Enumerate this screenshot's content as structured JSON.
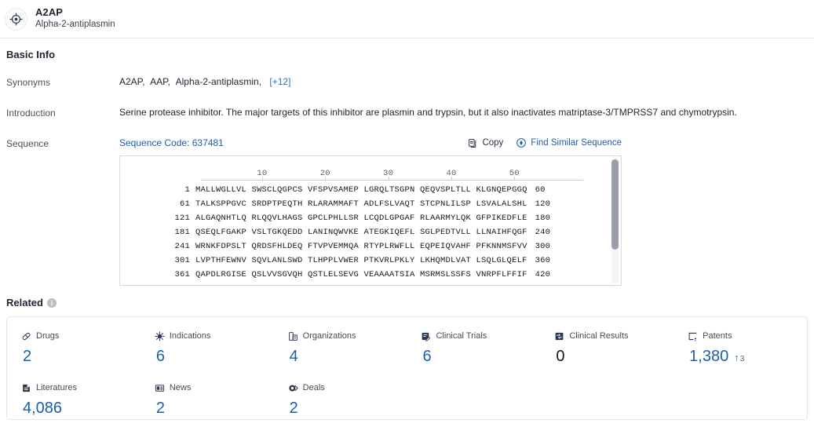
{
  "header": {
    "icon": "target-icon",
    "name": "A2AP",
    "subtitle": "Alpha-2-antiplasmin"
  },
  "basic_info": {
    "title": "Basic Info",
    "synonyms_label": "Synonyms",
    "synonyms": [
      "A2AP,",
      "AAP,",
      "Alpha-2-antiplasmin,"
    ],
    "synonyms_more": "[+12]",
    "introduction_label": "Introduction",
    "introduction": "Serine protease inhibitor. The major targets of this inhibitor are plasmin and trypsin, but it also inactivates matriptase-3/TMPRSS7 and chymotrypsin.",
    "sequence_label": "Sequence",
    "sequence_code": "Sequence Code: 637481",
    "copy_label": "Copy",
    "find_similar_label": "Find Similar Sequence"
  },
  "sequence_viewer": {
    "ruler_ticks": [
      "10",
      "20",
      "30",
      "40",
      "50"
    ],
    "rows": [
      {
        "start": "1",
        "letters": "MALLWGLLVL SWSCLQGPCS VFSPVSAMEP LGRQLTSGPN QEQVSPLTLL KLGNQEPGGQ",
        "end": "60"
      },
      {
        "start": "61",
        "letters": "TALKSPPGVC SRDPTPEQTH RLARAMMAFT ADLFSLVAQT STCPNLILSP LSVALALSHL",
        "end": "120"
      },
      {
        "start": "121",
        "letters": "ALGAQNHTLQ RLQQVLHAGS GPCLPHLLSR LCQDLGPGAF RLAARMYLQK GFPIKEDFLE",
        "end": "180"
      },
      {
        "start": "181",
        "letters": "QSEQLFGAKP VSLTGKQEDD LANINQWVKE ATEGKIQEFL SGLPEDTVLL LLNAIHFQGF",
        "end": "240"
      },
      {
        "start": "241",
        "letters": "WRNKFDPSLT QRDSFHLDEQ FTVPVEMMQA RTYPLRWFLL EQPEIQVAHF PFKNNMSFVV",
        "end": "300"
      },
      {
        "start": "301",
        "letters": "LVPTHFEWNV SQVLANLSWD TLHPPLVWER PTKVRLPKLY LKHQMDLVAT LSQLGLQELF",
        "end": "360"
      },
      {
        "start": "361",
        "letters": "QAPDLRGISE QSLVVSGVQH QSTLELSEVG VEAAAATSIA MSRMSLSSFS VNRPFLFFIF",
        "end": "420"
      }
    ],
    "scroll_position_pct": 0
  },
  "related": {
    "title": "Related",
    "info_badge": "i",
    "stats": [
      {
        "icon": "pill-icon",
        "label": "Drugs",
        "value": "2",
        "zero": false
      },
      {
        "icon": "virus-icon",
        "label": "Indications",
        "value": "6",
        "zero": false
      },
      {
        "icon": "organization-icon",
        "label": "Organizations",
        "value": "4",
        "zero": false
      },
      {
        "icon": "clinical-trial-icon",
        "label": "Clinical Trials",
        "value": "6",
        "zero": false
      },
      {
        "icon": "clinical-result-icon",
        "label": "Clinical Results",
        "value": "0",
        "zero": true
      },
      {
        "icon": "patent-icon",
        "label": "Patents",
        "value": "1,380",
        "zero": false,
        "delta_arrow": "↑",
        "delta_value": "3"
      },
      {
        "icon": "literature-icon",
        "label": "Literatures",
        "value": "4,086",
        "zero": false
      },
      {
        "icon": "news-icon",
        "label": "News",
        "value": "2",
        "zero": false
      },
      {
        "icon": "deal-icon",
        "label": "Deals",
        "value": "2",
        "zero": false
      }
    ]
  },
  "colors": {
    "accent_blue": "#1b5fa8",
    "link_blue": "#2d6fbe",
    "up_green": "#14a24a",
    "icon_navy": "#2b3650"
  }
}
